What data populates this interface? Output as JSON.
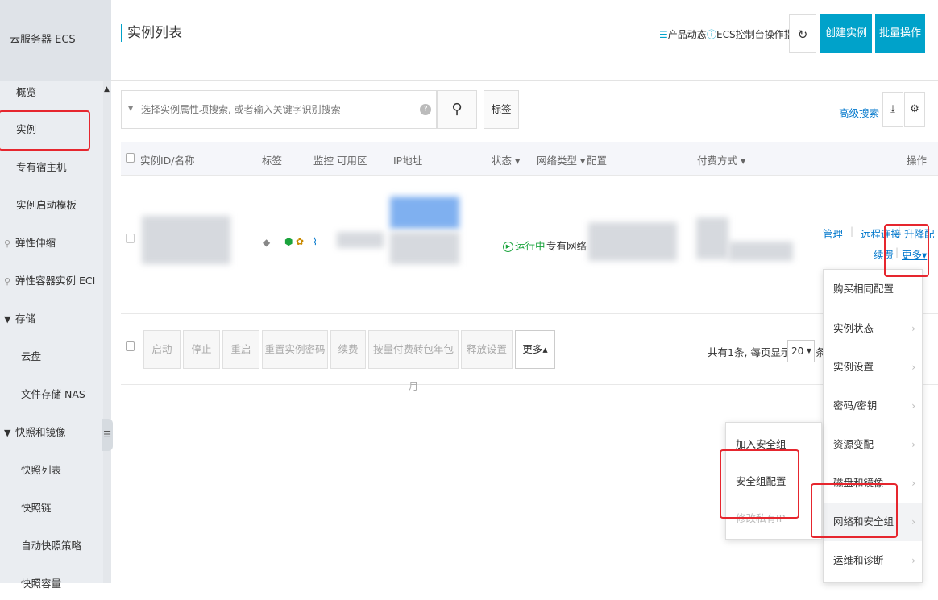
{
  "sidebar": {
    "title": "云服务器 ECS",
    "items": [
      {
        "label": "概览",
        "prefix": ""
      },
      {
        "label": "实例",
        "prefix": ""
      },
      {
        "label": "专有宿主机",
        "prefix": ""
      },
      {
        "label": "实例启动模板",
        "prefix": ""
      },
      {
        "label": "弹性伸缩",
        "prefix": "⚲"
      },
      {
        "label": "弹性容器实例 ECI",
        "prefix": "⚲"
      },
      {
        "label": "存储",
        "prefix": "▼"
      },
      {
        "label": "云盘",
        "prefix": ""
      },
      {
        "label": "文件存储 NAS",
        "prefix": ""
      },
      {
        "label": "快照和镜像",
        "prefix": "▼"
      },
      {
        "label": "快照列表",
        "prefix": ""
      },
      {
        "label": "快照链",
        "prefix": ""
      },
      {
        "label": "自动快照策略",
        "prefix": ""
      },
      {
        "label": "快照容量",
        "prefix": ""
      }
    ]
  },
  "header": {
    "title": "实例列表",
    "product_news": "产品动态",
    "console_guide": "ECS控制台操作指南",
    "create_instance": "创建实例",
    "batch_ops": "批量操作"
  },
  "search": {
    "placeholder": "选择实例属性项搜索, 或者输入关键字识别搜索",
    "tag_label": "标签",
    "advanced": "高级搜索"
  },
  "table": {
    "headers": [
      "实例ID/名称",
      "标签",
      "监控",
      "可用区",
      "IP地址",
      "状态 ▾",
      "网络类型 ▾",
      "配置",
      "付费方式 ▾",
      "操作"
    ],
    "row": {
      "status": "运行中",
      "network": "专有网络",
      "ops": {
        "manage": "管理",
        "remote": "远程连接",
        "upgrade": "升降配",
        "renew": "续费",
        "more": "更多▾"
      }
    }
  },
  "bulk_actions": [
    "启动",
    "停止",
    "重启",
    "重置实例密码",
    "续费",
    "按量付费转包年包月",
    "释放设置",
    "更多▴"
  ],
  "pager": {
    "summary": "共有1条, 每页显示:",
    "page_size": "20",
    "unit": "条"
  },
  "more_menu": [
    {
      "label": "购买相同配置",
      "has_sub": false
    },
    {
      "label": "实例状态",
      "has_sub": true
    },
    {
      "label": "实例设置",
      "has_sub": true
    },
    {
      "label": "密码/密钥",
      "has_sub": true
    },
    {
      "label": "资源变配",
      "has_sub": true
    },
    {
      "label": "磁盘和镜像",
      "has_sub": true
    },
    {
      "label": "网络和安全组",
      "has_sub": true
    },
    {
      "label": "运维和诊断",
      "has_sub": true
    }
  ],
  "sub_menu": [
    {
      "label": "加入安全组",
      "disabled": false
    },
    {
      "label": "安全组配置",
      "disabled": false
    },
    {
      "label": "修改私有IP",
      "disabled": true
    }
  ],
  "colors": {
    "accent": "#00a2ca",
    "link": "#0077cc",
    "running": "#1aa33c",
    "highlight": "#e6262e"
  }
}
